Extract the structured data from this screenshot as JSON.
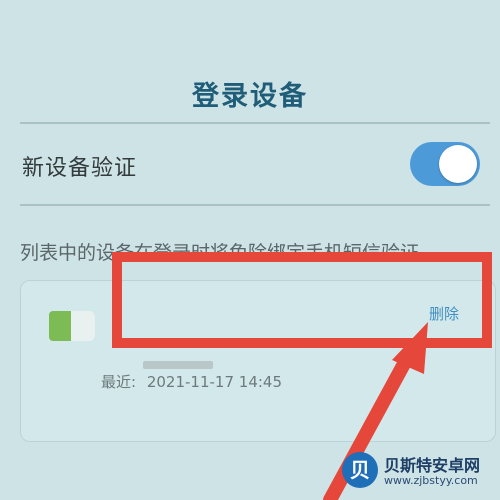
{
  "header": {
    "title": "登录设备"
  },
  "verification": {
    "label": "新设备验证",
    "toggle_on": true,
    "accent": "#4d9ad8"
  },
  "hint": {
    "text": "列表中的设备在登录时将免除绑定手机短信验证"
  },
  "device": {
    "delete_label": "删除",
    "recent_label": "最近:",
    "recent_time": "2021-11-17 14:45"
  },
  "watermark": {
    "title": "贝斯特安卓网",
    "url": "www.zjbstyy.com",
    "logo_glyph": "贝"
  },
  "colors": {
    "background": "#cde3e6",
    "title": "#1f5d78",
    "highlight": "#e5473b",
    "link": "#3f8fc4"
  }
}
